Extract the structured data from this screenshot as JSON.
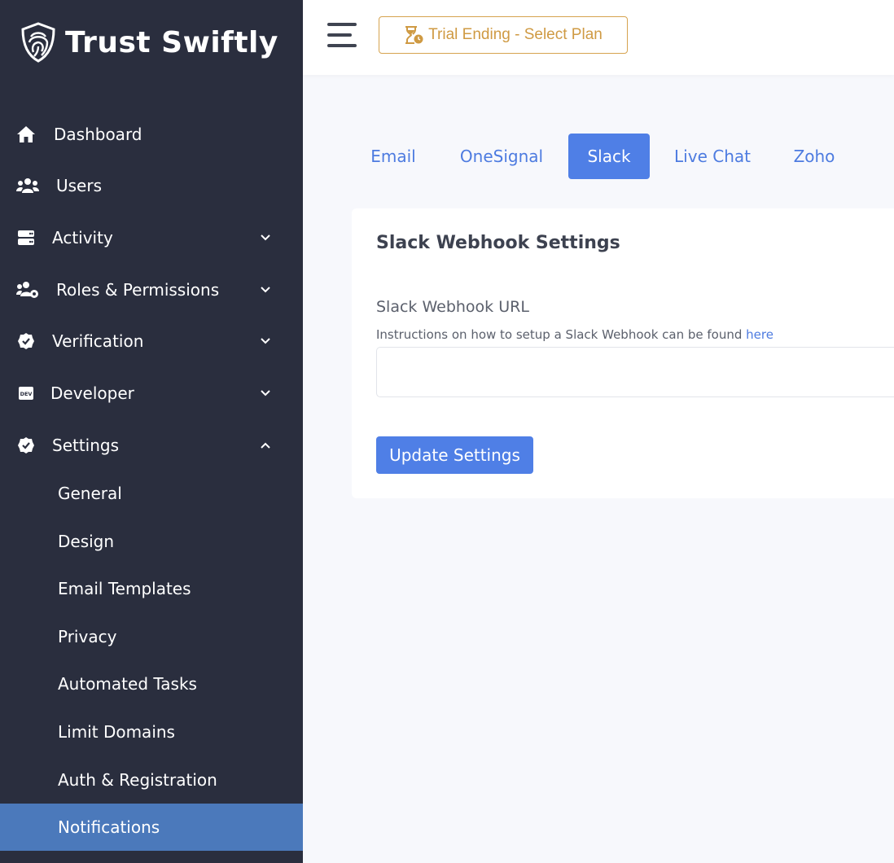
{
  "brand": {
    "name": "Trust Swiftly",
    "logo_icon": "fingerprint-shield-icon"
  },
  "sidebar": {
    "items": [
      {
        "label": "Dashboard",
        "icon": "home-icon"
      },
      {
        "label": "Users",
        "icon": "users-icon"
      },
      {
        "label": "Activity",
        "icon": "server-icon",
        "expandable": true,
        "expanded": false
      },
      {
        "label": "Roles & Permissions",
        "icon": "users-gear-icon",
        "expandable": true,
        "expanded": false
      },
      {
        "label": "Verification",
        "icon": "badge-check-icon",
        "expandable": true,
        "expanded": false
      },
      {
        "label": "Developer",
        "icon": "dev-icon",
        "expandable": true,
        "expanded": false
      },
      {
        "label": "Settings",
        "icon": "badge-check-icon",
        "expandable": true,
        "expanded": true
      }
    ],
    "settings_subitems": [
      {
        "label": "General"
      },
      {
        "label": "Design"
      },
      {
        "label": "Email Templates"
      },
      {
        "label": "Privacy"
      },
      {
        "label": "Automated Tasks"
      },
      {
        "label": "Limit Domains"
      },
      {
        "label": "Auth & Registration"
      },
      {
        "label": "Notifications",
        "active": true
      }
    ]
  },
  "topbar": {
    "trial_button": "Trial Ending - Select Plan",
    "trial_icon": "hourglass-clock-icon"
  },
  "tabs": [
    {
      "label": "Email"
    },
    {
      "label": "OneSignal"
    },
    {
      "label": "Slack",
      "active": true
    },
    {
      "label": "Live Chat"
    },
    {
      "label": "Zoho"
    }
  ],
  "card": {
    "title": "Slack Webhook Settings",
    "field_label": "Slack Webhook URL",
    "help_text": "Instructions on how to setup a Slack Webhook can be found ",
    "help_link": "here",
    "input_value": "",
    "submit_label": "Update Settings"
  },
  "colors": {
    "sidebar_bg": "#2a2e3e",
    "sidebar_active": "#4b79bb",
    "accent": "#4f7fe6",
    "trial": "#cf9a43",
    "page_bg": "#f7f8fc"
  }
}
